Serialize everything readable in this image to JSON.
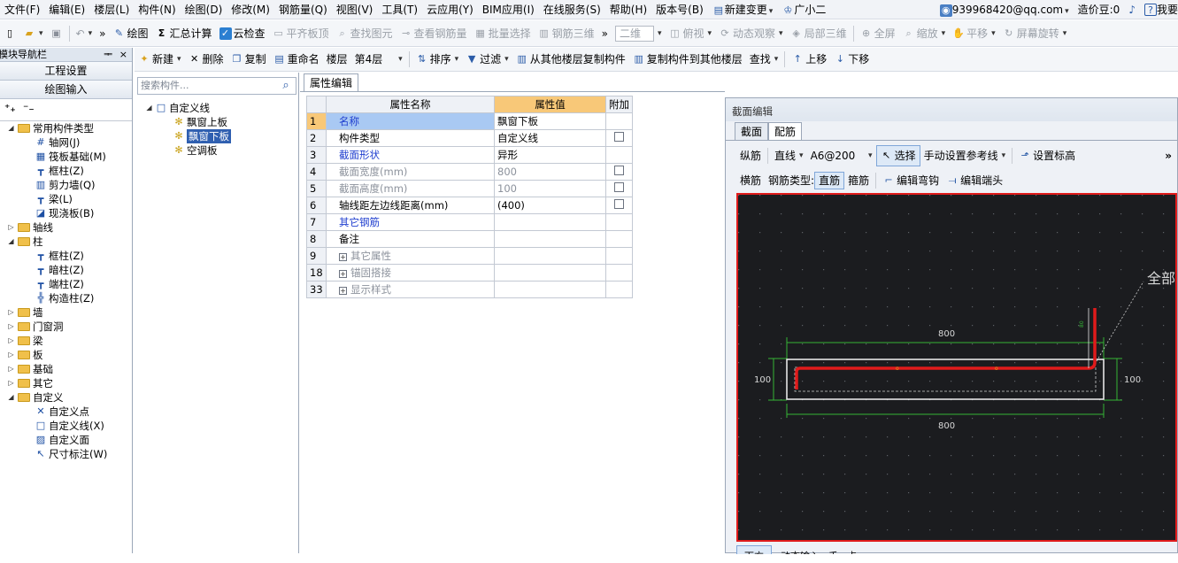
{
  "menu": [
    "文件(F)",
    "编辑(E)",
    "楼层(L)",
    "构件(N)",
    "绘图(D)",
    "修改(M)",
    "钢筋量(Q)",
    "视图(V)",
    "工具(T)",
    "云应用(Y)",
    "BIM应用(I)",
    "在线服务(S)",
    "帮助(H)",
    "版本号(B)",
    "新建变更",
    "广小二"
  ],
  "account": {
    "email": "939968420@qq.com",
    "beans": "造价豆:0",
    "help": "我要"
  },
  "toolbar1": {
    "draw": "绘图",
    "sum": "汇总计算",
    "cloud_check": "云检查",
    "flat_board": "平齐板顶",
    "find_elem": "查找图元",
    "view_rebar": "查看钢筋量",
    "batch_select": "批量选择",
    "rebar_3d": "钢筋三维",
    "view_mode": "二维",
    "top_view": "俯视",
    "dyn_observe": "动态观察",
    "local_3d": "局部三维",
    "fullscreen": "全屏",
    "zoom": "缩放",
    "pan": "平移",
    "rotate": "屏幕旋转"
  },
  "toolbar2": {
    "new": "新建",
    "delete": "删除",
    "copy": "复制",
    "rename": "重命名",
    "floor_label": "楼层",
    "floor_value": "第4层",
    "sort": "排序",
    "filter": "过滤",
    "copy_from": "从其他楼层复制构件",
    "copy_to": "复制构件到其他楼层",
    "find": "查找",
    "up": "上移",
    "down": "下移"
  },
  "nav": {
    "title": "模块导航栏",
    "pin": "ᅟ 4 ×",
    "btn_settings": "工程设置",
    "btn_draw": "绘图输入"
  },
  "tree": [
    {
      "label": "常用构件类型",
      "type": "folder",
      "level": 0,
      "exp": "▲"
    },
    {
      "label": "轴网(J)",
      "type": "item",
      "level": 2,
      "icon": "#"
    },
    {
      "label": "筏板基础(M)",
      "type": "item",
      "level": 2,
      "icon": "▦"
    },
    {
      "label": "框柱(Z)",
      "type": "item",
      "level": 2,
      "icon": "┳"
    },
    {
      "label": "剪力墙(Q)",
      "type": "item",
      "level": 2,
      "icon": "▥"
    },
    {
      "label": "梁(L)",
      "type": "item",
      "level": 2,
      "icon": "┳"
    },
    {
      "label": "现浇板(B)",
      "type": "item",
      "level": 2,
      "icon": "◪"
    },
    {
      "label": "轴线",
      "type": "folder",
      "level": 0,
      "exp": "▷"
    },
    {
      "label": "柱",
      "type": "folder",
      "level": 0,
      "exp": "▲"
    },
    {
      "label": "框柱(Z)",
      "type": "item",
      "level": 2,
      "icon": "┳"
    },
    {
      "label": "暗柱(Z)",
      "type": "item",
      "level": 2,
      "icon": "┳"
    },
    {
      "label": "端柱(Z)",
      "type": "item",
      "level": 2,
      "icon": "┳"
    },
    {
      "label": "构造柱(Z)",
      "type": "item",
      "level": 2,
      "icon": "╬"
    },
    {
      "label": "墙",
      "type": "folder",
      "level": 0,
      "exp": "▷"
    },
    {
      "label": "门窗洞",
      "type": "folder",
      "level": 0,
      "exp": "▷"
    },
    {
      "label": "梁",
      "type": "folder",
      "level": 0,
      "exp": "▷"
    },
    {
      "label": "板",
      "type": "folder",
      "level": 0,
      "exp": "▷"
    },
    {
      "label": "基础",
      "type": "folder",
      "level": 0,
      "exp": "▷"
    },
    {
      "label": "其它",
      "type": "folder",
      "level": 0,
      "exp": "▷"
    },
    {
      "label": "自定义",
      "type": "folder",
      "level": 0,
      "exp": "▲"
    },
    {
      "label": "自定义点",
      "type": "item",
      "level": 2,
      "icon": "✕"
    },
    {
      "label": "自定义线(X)",
      "type": "item",
      "level": 2,
      "icon": "□"
    },
    {
      "label": "自定义面",
      "type": "item",
      "level": 2,
      "icon": "▨"
    },
    {
      "label": "尺寸标注(W)",
      "type": "item",
      "level": 2,
      "icon": "↖"
    }
  ],
  "components": {
    "search_placeholder": "搜索构件...",
    "root": "自定义线",
    "items": [
      "飘窗上板",
      "飘窗下板",
      "空调板"
    ],
    "selected": "飘窗下板"
  },
  "props": {
    "tab": "属性编辑",
    "headers": [
      "属性名称",
      "属性值",
      "附加"
    ],
    "rows": [
      {
        "n": "1",
        "name": "名称",
        "value": "飘窗下板",
        "style": "blue",
        "cb": false,
        "sel": true
      },
      {
        "n": "2",
        "name": "构件类型",
        "value": "自定义线",
        "style": "",
        "cb": true
      },
      {
        "n": "3",
        "name": "截面形状",
        "value": "异形",
        "style": "blue",
        "cb": false
      },
      {
        "n": "4",
        "name": "截面宽度(mm)",
        "value": "800",
        "style": "grey",
        "cb": true
      },
      {
        "n": "5",
        "name": "截面高度(mm)",
        "value": "100",
        "style": "grey",
        "cb": true
      },
      {
        "n": "6",
        "name": "轴线距左边线距离(mm)",
        "value": "(400)",
        "style": "",
        "cb": true
      },
      {
        "n": "7",
        "name": "其它钢筋",
        "value": "",
        "style": "blue",
        "cb": false
      },
      {
        "n": "8",
        "name": "备注",
        "value": "",
        "style": "",
        "cb": false
      },
      {
        "n": "9",
        "name": "其它属性",
        "value": "",
        "style": "grey",
        "cb": false,
        "plus": true
      },
      {
        "n": "18",
        "name": "锚固搭接",
        "value": "",
        "style": "grey",
        "cb": false,
        "plus": true
      },
      {
        "n": "33",
        "name": "显示样式",
        "value": "",
        "style": "grey",
        "cb": false,
        "plus": true
      }
    ]
  },
  "section": {
    "title": "截面编辑",
    "tabs": [
      "截面",
      "配筋"
    ],
    "tb1": {
      "long": "纵筋",
      "line": "直线",
      "spec": "A6@200",
      "select": "选择",
      "manual": "手动设置参考线",
      "elev": "设置标高"
    },
    "tb2": {
      "horiz": "横筋",
      "type_label": "钢筋类型:",
      "straight": "直筋",
      "stirrup": "箍筋",
      "edit_hook": "编辑弯钩",
      "edit_end": "编辑端头"
    },
    "canvas": {
      "dim_top": "800",
      "dim_bottom": "800",
      "dim_left": "100",
      "dim_right": "100",
      "partial_label": "全部"
    },
    "bottom_tabs": [
      "下方",
      "动态输入",
      "手",
      "点"
    ]
  },
  "colors": {
    "accent": "#1f3ecf",
    "header_orange": "#f8c878",
    "rebar_red": "#e01b1b",
    "dim_green": "#35b535"
  }
}
